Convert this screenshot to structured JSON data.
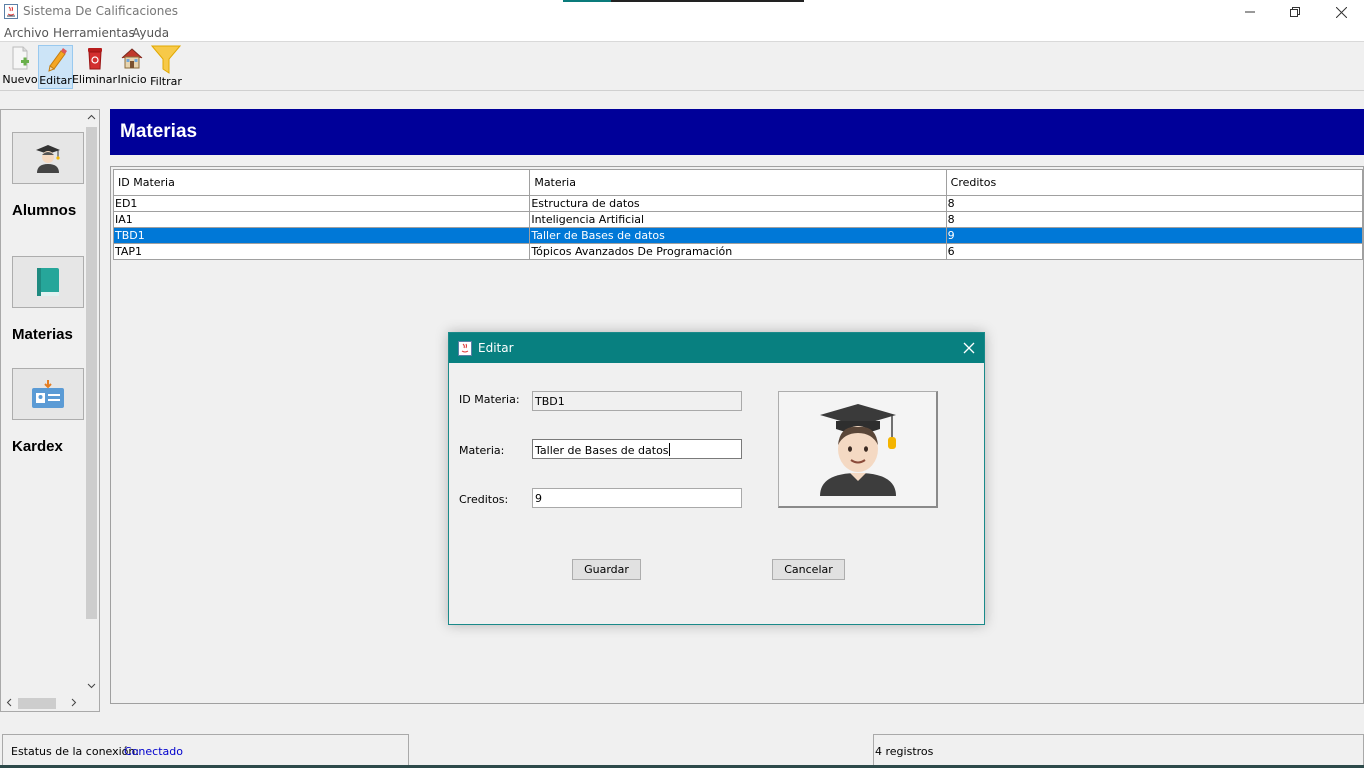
{
  "window": {
    "title": "Sistema De Calificaciones",
    "minimize_icon": "minimize-icon",
    "restore_icon": "restore-icon",
    "close_icon": "close-icon"
  },
  "menu": [
    "Archivo",
    "Herramientas",
    "Ayuda"
  ],
  "toolbar": [
    {
      "label": "Nuevo",
      "icon": "new-document-icon"
    },
    {
      "label": "Editar",
      "icon": "pencil-icon",
      "active": true
    },
    {
      "label": "Eliminar",
      "icon": "recycle-bin-icon"
    },
    {
      "label": "Inicio",
      "icon": "home-icon"
    },
    {
      "label": "Filtrar",
      "icon": "funnel-icon"
    }
  ],
  "sidebar": {
    "items": [
      {
        "label": "Alumnos",
        "icon": "student-icon"
      },
      {
        "label": "Materias",
        "icon": "book-icon"
      },
      {
        "label": "Kardex",
        "icon": "id-card-icon"
      }
    ]
  },
  "header": {
    "title": "Materias"
  },
  "table": {
    "columns": [
      "ID Materia",
      "Materia",
      "Creditos"
    ],
    "rows": [
      [
        "ED1",
        "Estructura de datos",
        "8"
      ],
      [
        "IA1",
        "Inteligencia Artificial",
        "8"
      ],
      [
        "TBD1",
        "Taller de Bases de datos",
        "9"
      ],
      [
        "TAP1",
        "Tópicos Avanzados De Programación",
        "6"
      ]
    ],
    "selected_row": 2
  },
  "dialog": {
    "title": "Editar",
    "fields": {
      "id_label": "ID Materia:",
      "id_value": "TBD1",
      "materia_label": "Materia:",
      "materia_value": "Taller de Bases de datos",
      "creditos_label": "Creditos:",
      "creditos_value": "9"
    },
    "save_label": "Guardar",
    "cancel_label": "Cancelar"
  },
  "status": {
    "connection_label": "Estatus de la conexión:",
    "connection_value": "Conectado",
    "records": "4 registros"
  },
  "colors": {
    "header_bg": "#000099",
    "dialog_title_bg": "#088080",
    "selection": "#0078d7",
    "connected": "#0000cc"
  }
}
